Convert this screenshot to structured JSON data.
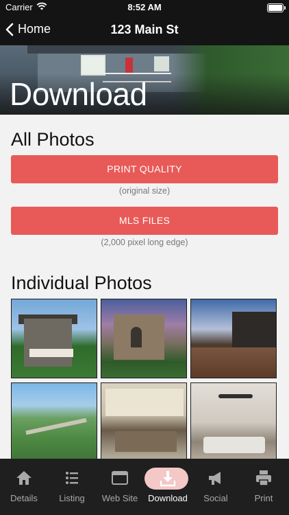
{
  "status": {
    "carrier": "Carrier",
    "time": "8:52 AM"
  },
  "nav": {
    "back_label": "Home",
    "title": "123 Main St"
  },
  "hero": {
    "title": "Download"
  },
  "all_photos": {
    "heading": "All Photos",
    "print_button": "PRINT QUALITY",
    "print_caption": "(original size)",
    "mls_button": "MLS FILES",
    "mls_caption": "(2,000 pixel long edge)"
  },
  "individual": {
    "heading": "Individual Photos"
  },
  "tabs": [
    {
      "label": "Details",
      "icon": "home-icon"
    },
    {
      "label": "Listing",
      "icon": "list-icon"
    },
    {
      "label": "Web Site",
      "icon": "browser-window-icon"
    },
    {
      "label": "Download",
      "icon": "download-icon"
    },
    {
      "label": "Social",
      "icon": "megaphone-icon"
    },
    {
      "label": "Print",
      "icon": "printer-icon"
    }
  ],
  "colors": {
    "accent": "#e85a57",
    "active_tab_pill": "#f3c8c6",
    "tab_bar": "#1f1f1f",
    "nav_bar": "#141414"
  }
}
